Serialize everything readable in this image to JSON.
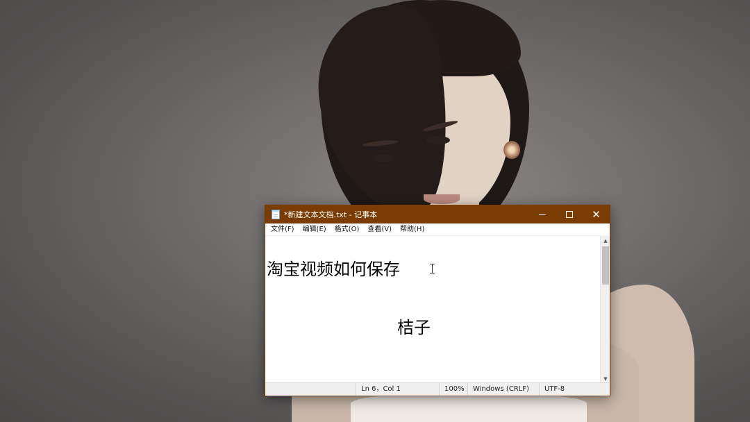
{
  "window": {
    "title": "*新建文本文档.txt - 记事本",
    "controls": {
      "minimize": "minimize",
      "maximize": "maximize",
      "close": "✕"
    }
  },
  "menu": {
    "items": [
      {
        "label": "文件(F)"
      },
      {
        "label": "编辑(E)"
      },
      {
        "label": "格式(O)"
      },
      {
        "label": "查看(V)"
      },
      {
        "label": "帮助(H)"
      }
    ]
  },
  "editor": {
    "lines": [
      "淘宝视频如何保存",
      "桔子"
    ]
  },
  "status": {
    "position": "Ln 6，Col 1",
    "zoom": "100%",
    "line_ending": "Windows (CRLF)",
    "encoding": "UTF-8"
  },
  "colors": {
    "titlebar": "#7a3c02",
    "background": "#6f6b6b"
  },
  "icons": {
    "app": "notepad-icon",
    "cursor": "text-cursor-icon"
  }
}
